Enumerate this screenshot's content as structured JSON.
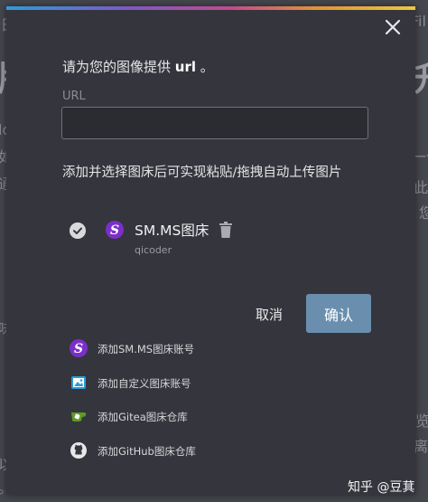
{
  "background": {
    "fragments": [
      "田",
      "Fil",
      "版！",
      "升",
      "low",
      "如果",
      "一个",
      "通过",
      "此",
      "您",
      "味着",
      "览",
      "离",
      "以通",
      "。您"
    ]
  },
  "modal": {
    "close_icon": "close-icon",
    "title_prefix": "请为您的图像提供",
    "title_bold": "url",
    "title_suffix": "。",
    "url_label": "URL",
    "url_value": "",
    "hint": "添加并选择图床后可实现粘贴/拖拽自动上传图片",
    "selected_host": {
      "icon": "smms-logo-icon",
      "name": "SM.MS图床",
      "user": "qicoder",
      "checked": true
    },
    "cancel_label": "取消",
    "confirm_label": "确认",
    "add_options": [
      {
        "icon": "smms-logo-icon",
        "label": "添加SM.MS图床账号"
      },
      {
        "icon": "custom-host-icon",
        "label": "添加自定义图床账号"
      },
      {
        "icon": "gitea-icon",
        "label": "添加Gitea图床仓库"
      },
      {
        "icon": "github-icon",
        "label": "添加GitHub图床仓库"
      }
    ]
  },
  "watermark": "知乎 @豆萁",
  "colors": {
    "modal_bg": "#35363d",
    "confirm_bg": "#6a8fae",
    "smms_purple": "#7b2fc9",
    "gitea_green": "#609926"
  }
}
